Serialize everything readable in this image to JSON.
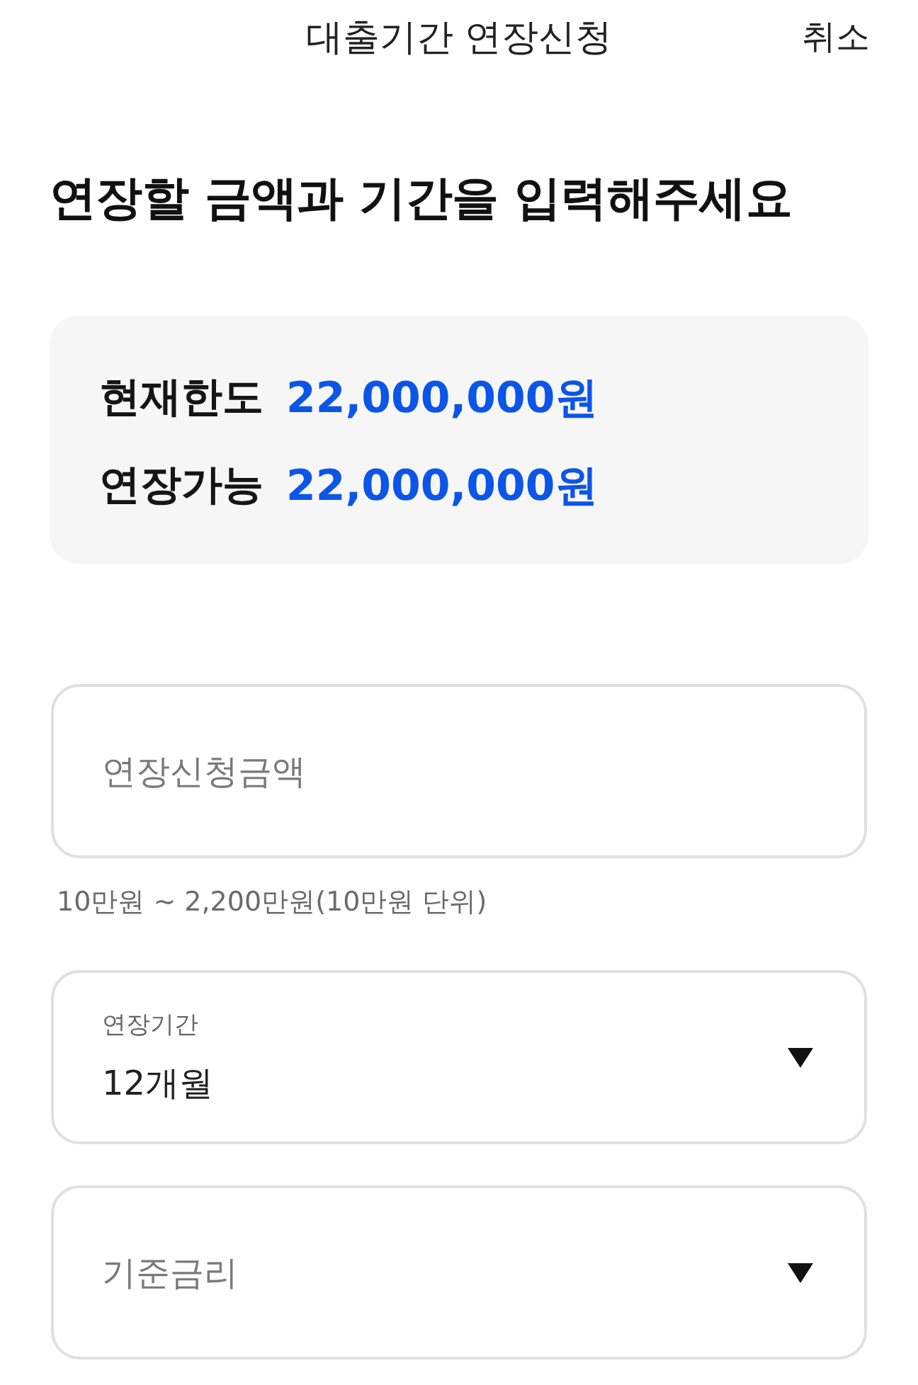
{
  "header": {
    "title": "대출기간 연장신청",
    "cancel": "취소"
  },
  "heading": "연장할 금액과 기간을 입력해주세요",
  "summary": {
    "rows": [
      {
        "label": "현재한도",
        "value": "22,000,000원"
      },
      {
        "label": "연장가능",
        "value": "22,000,000원"
      }
    ]
  },
  "form": {
    "fields": [
      {
        "kind": "text",
        "placeholder": "연장신청금액",
        "helper": "10만원 ~ 2,200만원(10만원 단위)"
      },
      {
        "kind": "select",
        "label": "연장기간",
        "value": "12개월"
      },
      {
        "kind": "select",
        "placeholder": "기준금리"
      }
    ]
  }
}
